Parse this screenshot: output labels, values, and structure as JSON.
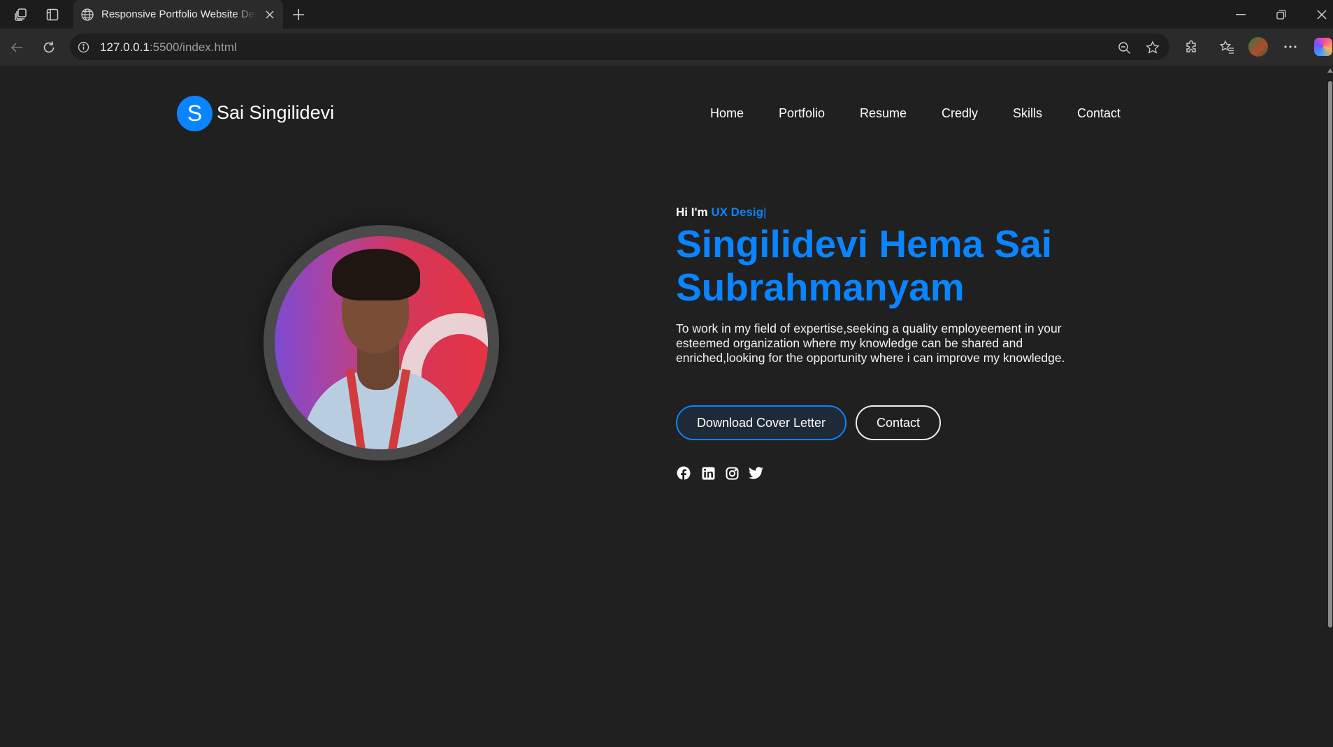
{
  "browser": {
    "tab_title": "Responsive Portfolio Website Design",
    "url_host": "127.0.0.1",
    "url_rest": ":5500/index.html"
  },
  "header": {
    "logo_letter": "S",
    "logo_text": "Sai Singilidevi",
    "nav": [
      {
        "label": "Home"
      },
      {
        "label": "Portfolio"
      },
      {
        "label": "Resume"
      },
      {
        "label": "Credly"
      },
      {
        "label": "Skills"
      },
      {
        "label": "Contact"
      }
    ]
  },
  "hero": {
    "greeting_prefix": "Hi I'm",
    "typed_text": "UX Desig",
    "caret": "|",
    "name": "Singilidevi Hema Sai Subrahmanyam",
    "description": "To work in my field of expertise,seeking a quality employeement in your esteemed organization where my knowledge can be shared and enriched,looking for the opportunity where i can improve my knowledge.",
    "primary_button": "Download Cover Letter",
    "secondary_button": "Contact",
    "socials": [
      "facebook-icon",
      "linkedin-icon",
      "instagram-icon",
      "twitter-icon"
    ]
  },
  "colors": {
    "accent": "#0a84ff",
    "background": "#202020",
    "text": "#ffffff"
  }
}
